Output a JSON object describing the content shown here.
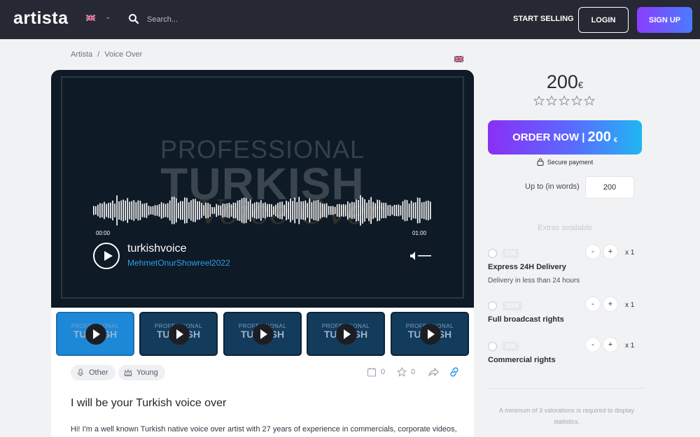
{
  "header": {
    "logo": "artista",
    "search_placeholder": "Search...",
    "start_selling": "START SELLING",
    "login": "LOGIN",
    "signup": "SIGN UP"
  },
  "breadcrumb": [
    "Artista",
    "/",
    "Voice Over"
  ],
  "player": {
    "bg_line1": "PROFESSIONAL",
    "bg_line2": "TURKISH",
    "bg_script": "Voice Over",
    "time_start": "00:00",
    "time_end": "01:00",
    "track_name": "turkishvoice",
    "track_sub": "MehmetOnurShowreel2022"
  },
  "thumbnails": [
    {
      "line1": "PROFESSIONAL",
      "line2": "TURKISH"
    },
    {
      "line1": "PROFESSIONAL",
      "line2": "TURKISH"
    },
    {
      "line1": "PROFESSIONAL",
      "line2": "TURKISH"
    },
    {
      "line1": "PROFESSIONAL",
      "line2": "TURKISH"
    },
    {
      "line1": "PROFESSIONAL",
      "line2": "TURKISH"
    }
  ],
  "tags": [
    "Other",
    "Young"
  ],
  "stats": {
    "orders": "0",
    "favorites": "0"
  },
  "gig": {
    "title": "I will be your Turkish voice over",
    "description": "Hi! I'm a well known Turkish native voice over artist with 27 years of experience in commercials, corporate videos,"
  },
  "pricing": {
    "price": "200",
    "currency": "€",
    "order_label": "ORDER NOW |",
    "order_price": "200",
    "order_currency": "€",
    "secure": "Secure payment",
    "upto_label": "Up to (in words)",
    "upto_value": "200",
    "extras_title": "Extras available",
    "extras": [
      {
        "price": "50€",
        "name": "Express 24H Delivery",
        "desc": "Delivery in less than 24 hours",
        "qty": "x 1"
      },
      {
        "price": "200€",
        "name": "Full broadcast rights",
        "desc": "",
        "qty": "x 1"
      },
      {
        "price": "50€",
        "name": "Commercial rights",
        "desc": "",
        "qty": "x 1"
      }
    ],
    "minus": "-",
    "plus": "+",
    "valuation_note": "A minimum of 3 valorations is required to display statistics."
  },
  "colors": {
    "header_bg": "#262833",
    "accent_blue": "#2f9fe6",
    "gradient_start": "#8a2ff5",
    "gradient_end": "#20b6f1"
  }
}
